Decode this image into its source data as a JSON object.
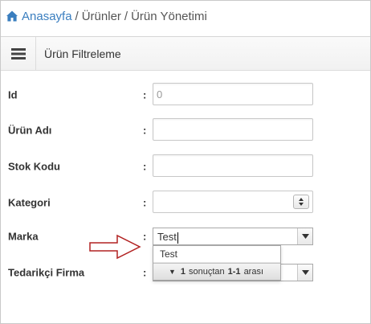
{
  "breadcrumb": {
    "home_label": "Anasayfa",
    "separator": "/",
    "items": [
      "Ürünler",
      "Ürün Yönetimi"
    ]
  },
  "panel": {
    "title": "Ürün Filtreleme",
    "menu_icon": "hamburger-icon"
  },
  "form": {
    "colon": ":",
    "id": {
      "label": "Id",
      "value": "0"
    },
    "urun_adi": {
      "label": "Ürün Adı",
      "value": ""
    },
    "stok_kodu": {
      "label": "Stok Kodu",
      "value": ""
    },
    "kategori": {
      "label": "Kategori",
      "value": ""
    },
    "marka": {
      "label": "Marka",
      "value": "Test"
    },
    "tedarikci": {
      "label": "Tedarikçi Firma",
      "value": ""
    }
  },
  "dropdown": {
    "items": [
      "Test"
    ],
    "pager": {
      "from": "1",
      "text1": "sonuçtan",
      "range": "1-1",
      "text2": "arası"
    }
  },
  "colors": {
    "link": "#3a7ebf",
    "annotation_arrow": "#b22222"
  }
}
